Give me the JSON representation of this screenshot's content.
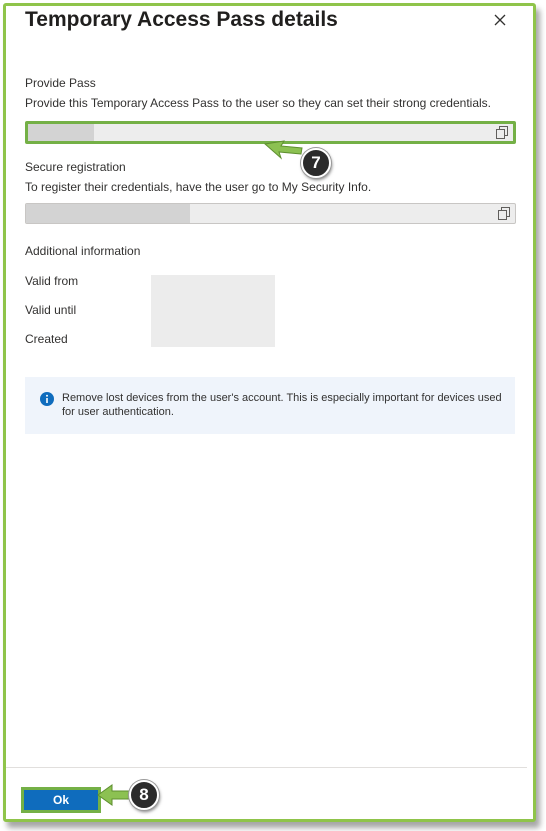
{
  "dialog": {
    "title": "Temporary Access Pass details"
  },
  "provide_pass": {
    "heading": "Provide Pass",
    "description": "Provide this Temporary Access Pass to the user so they can set their strong credentials."
  },
  "secure_registration": {
    "heading": "Secure registration",
    "description": "To register their credentials, have the user go to My Security Info."
  },
  "additional_info": {
    "heading": "Additional information",
    "valid_from_label": "Valid from",
    "valid_until_label": "Valid until",
    "created_label": "Created"
  },
  "info_banner": {
    "text": "Remove lost devices from the user's account. This is especially important for devices used for user authentication.",
    "icon": "info-icon"
  },
  "footer": {
    "ok_label": "Ok"
  },
  "annotations": {
    "step_7": "7",
    "step_8": "8"
  },
  "colors": {
    "highlight": "#74b046",
    "primary": "#0f6cbd",
    "info_bg": "#eff4fb"
  }
}
